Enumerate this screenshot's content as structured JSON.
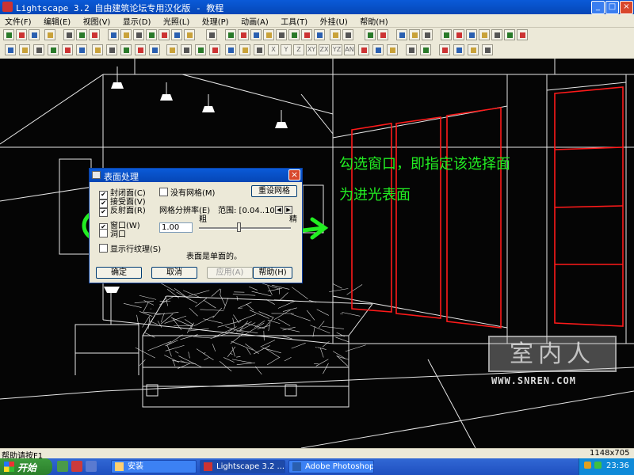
{
  "window": {
    "title": "Lightscape 3.2 自由建筑论坛专用汉化版  - 教程",
    "min_glyph": "_",
    "max_glyph": "□",
    "close_glyph": "×"
  },
  "menu": [
    "文件(F)",
    "编辑(E)",
    "视图(V)",
    "显示(D)",
    "光照(L)",
    "处理(P)",
    "动画(A)",
    "工具(T)",
    "外挂(U)",
    "帮助(H)"
  ],
  "toolbar2_labels": [
    "X",
    "Y",
    "Z",
    "XY",
    "ZX",
    "YZ",
    "AN"
  ],
  "annotation": {
    "line1": "勾选窗口，即指定该选择面",
    "line2": "为进光表面"
  },
  "dialog": {
    "title": "表面处理",
    "close_glyph": "×",
    "checkboxes": [
      {
        "label": "封闭面(C)",
        "checked": true
      },
      {
        "label": "接受面(V)",
        "checked": true
      },
      {
        "label": "反射面(R)",
        "checked": true
      },
      {
        "label": "窗口(W)",
        "checked": true
      },
      {
        "label": "洞口",
        "checked": false
      },
      {
        "label": "没有网格(M)",
        "checked": false
      },
      {
        "label": "显示行纹理(S)",
        "checked": false
      }
    ],
    "reset_mesh_button": "重设网格",
    "mesh_resolution_label": "网格分辨率(E)",
    "range_label": "范围: [0.04..100]",
    "coarse_label": "粗",
    "fine_label": "精",
    "mesh_value": "1.00",
    "surface_info": "表面是单面的。",
    "buttons": {
      "ok": "确定",
      "cancel": "取消",
      "apply": "应用(A)",
      "help": "帮助(H)"
    }
  },
  "watermark": {
    "main": "室内人",
    "url": "WWW.SNREN.COM"
  },
  "status": {
    "text": "帮助请按F1",
    "size": "1148x705"
  },
  "taskbar": {
    "start": "开始",
    "tasks": [
      {
        "label": "安装",
        "active": false
      },
      {
        "label": "Lightscape 3.2 ...",
        "active": true
      },
      {
        "label": "Adobe Photoshop",
        "active": false
      }
    ],
    "clock": "23:36"
  },
  "colors": {
    "annotation": "#22ee22",
    "highlight_edges": "#ff1a1a",
    "wireframe": "#ffffff"
  }
}
